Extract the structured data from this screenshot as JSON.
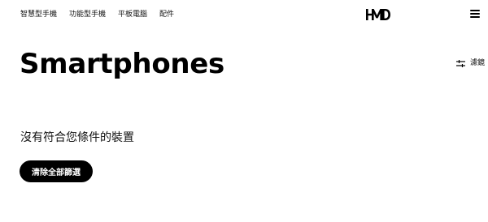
{
  "nav": {
    "items": [
      {
        "label": "智慧型手機"
      },
      {
        "label": "功能型手機"
      },
      {
        "label": "平板電腦"
      },
      {
        "label": "配件"
      }
    ]
  },
  "brand": {
    "logo_text": "HMD",
    "icon": "hmd-logo"
  },
  "menu": {
    "icon": "hamburger-menu-icon"
  },
  "main": {
    "title": "Smartphones",
    "filter_label": "濾鏡",
    "filter_icon": "sliders-icon",
    "empty_message": "沒有符合您條件的裝置",
    "clear_button_label": "清除全部篩選"
  },
  "colors": {
    "background": "#ffffff",
    "text": "#000000",
    "button_bg": "#000000",
    "button_text": "#ffffff"
  }
}
